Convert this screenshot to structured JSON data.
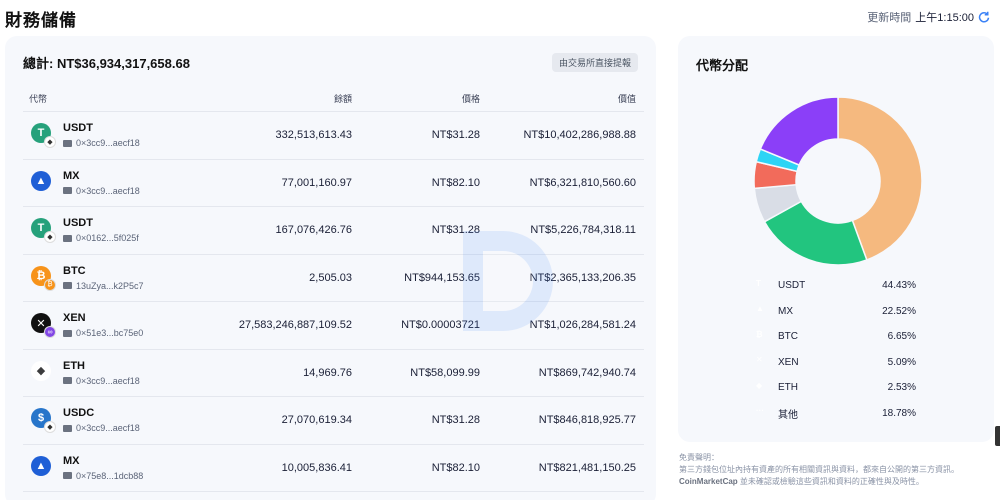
{
  "header": {
    "title": "財務儲備",
    "update_label": "更新時間",
    "update_time": "上午1:15:00"
  },
  "summary": {
    "total": "總計: NT$36,934,317,658.68",
    "exchange_label": "由交易所直接提報"
  },
  "table": {
    "columns": [
      "代幣",
      "餘額",
      "價格",
      "價值"
    ],
    "rows": [
      {
        "token": "USDT",
        "icon": "usdt-icon",
        "chain": "eth-chain-icon",
        "address": "0×3cc9...aecf18",
        "amount": "332,513,613.43",
        "price": "NT$31.28",
        "value": "NT$10,402,286,988.88"
      },
      {
        "token": "MX",
        "icon": "mx-icon",
        "chain": "",
        "address": "0×3cc9...aecf18",
        "amount": "77,001,160.97",
        "price": "NT$82.10",
        "value": "NT$6,321,810,560.60"
      },
      {
        "token": "USDT",
        "icon": "usdt-icon",
        "chain": "eth-chain-icon",
        "address": "0×0162...5f025f",
        "amount": "167,076,426.76",
        "price": "NT$31.28",
        "value": "NT$5,226,784,318.11"
      },
      {
        "token": "BTC",
        "icon": "btc-icon",
        "chain": "btc-chain-icon",
        "address": "13uZya...k2P5c7",
        "amount": "2,505.03",
        "price": "NT$944,153.65",
        "value": "NT$2,365,133,206.35"
      },
      {
        "token": "XEN",
        "icon": "xen-icon",
        "chain": "polygon-chain-icon",
        "address": "0×51e3...bc75e0",
        "amount": "27,583,246,887,109.52",
        "price": "NT$0.00003721",
        "value": "NT$1,026,284,581.24"
      },
      {
        "token": "ETH",
        "icon": "eth-icon",
        "chain": "",
        "address": "0×3cc9...aecf18",
        "amount": "14,969.76",
        "price": "NT$58,099.99",
        "value": "NT$869,742,940.74"
      },
      {
        "token": "USDC",
        "icon": "usdc-icon",
        "chain": "eth-chain-icon",
        "address": "0×3cc9...aecf18",
        "amount": "27,070,619.34",
        "price": "NT$31.28",
        "value": "NT$846,818,925.77"
      },
      {
        "token": "MX",
        "icon": "mx-icon",
        "chain": "",
        "address": "0×75e8...1dcb88",
        "amount": "10,005,836.41",
        "price": "NT$82.10",
        "value": "NT$821,481,150.25"
      }
    ]
  },
  "distribution": {
    "title": "代幣分配",
    "items": [
      {
        "name": "USDT",
        "pct": "44.43%",
        "value": 44.43,
        "color": "#f5b97f",
        "icon": "usdt-icon"
      },
      {
        "name": "MX",
        "pct": "22.52%",
        "value": 22.52,
        "color": "#22c57f",
        "icon": "mx-icon"
      },
      {
        "name": "BTC",
        "pct": "6.65%",
        "value": 6.65,
        "color": "#d9dde6",
        "icon": "btc-icon"
      },
      {
        "name": "XEN",
        "pct": "5.09%",
        "value": 5.09,
        "color": "#f26b5b",
        "icon": "xen-icon"
      },
      {
        "name": "ETH",
        "pct": "2.53%",
        "value": 2.53,
        "color": "#2dd4f5",
        "icon": "eth-icon"
      },
      {
        "name": "其他",
        "pct": "18.78%",
        "value": 18.78,
        "color": "#8b3ff8",
        "icon": "other-icon"
      }
    ]
  },
  "disclaimer": {
    "line1": "免責聲明：",
    "line2": "第三方錢包位址內持有資產的所有相關資訊與資料，都來自公開的第三方資訊。",
    "source": "CoinMarketCap",
    "line3": "並未確認或檢驗這些資訊和資料的正確性與及時性。"
  },
  "colors": {
    "usdt": "#26a17b",
    "mx": "#1f5fd6",
    "btc": "#f7931a",
    "xen": "#111111",
    "eth": "#3c3c3d",
    "usdc": "#2775ca",
    "accent": "#3b82f6"
  }
}
